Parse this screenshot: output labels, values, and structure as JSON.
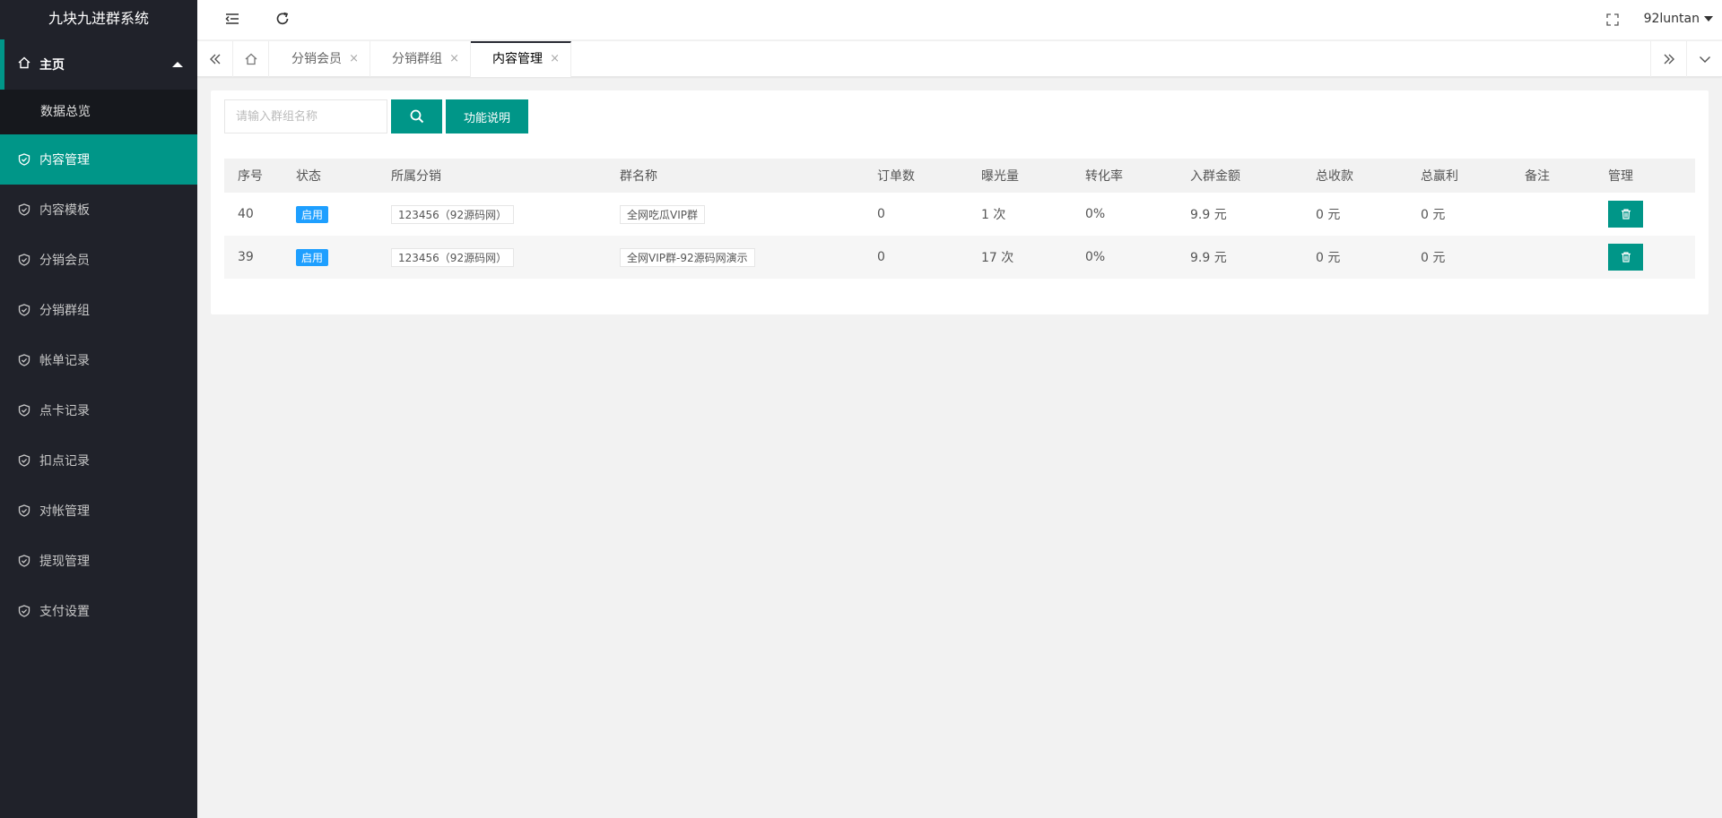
{
  "app": {
    "title": "九块九进群系统"
  },
  "sidebar": {
    "group": {
      "label": "主页",
      "items": [
        {
          "label": "数据总览"
        }
      ]
    },
    "items": [
      {
        "label": "内容管理",
        "active": true
      },
      {
        "label": "内容模板"
      },
      {
        "label": "分销会员"
      },
      {
        "label": "分销群组"
      },
      {
        "label": "帐单记录"
      },
      {
        "label": "点卡记录"
      },
      {
        "label": "扣点记录"
      },
      {
        "label": "对帐管理"
      },
      {
        "label": "提现管理"
      },
      {
        "label": "支付设置"
      }
    ]
  },
  "header": {
    "user": "92luntan"
  },
  "tabs": [
    {
      "label": "分销会员",
      "close": "×"
    },
    {
      "label": "分销群组",
      "close": "×"
    },
    {
      "label": "内容管理",
      "close": "×",
      "active": true
    }
  ],
  "toolbar": {
    "search_placeholder": "请输入群组名称",
    "help_label": "功能说明"
  },
  "table": {
    "headers": [
      "序号",
      "状态",
      "所属分销",
      "群名称",
      "订单数",
      "曝光量",
      "转化率",
      "入群金额",
      "总收款",
      "总赢利",
      "备注",
      "管理"
    ],
    "rows": [
      {
        "id": "40",
        "status": "启用",
        "distributor": "123456（92源码网）",
        "group": "全网吃瓜VIP群",
        "orders": "0",
        "views": "1 次",
        "rate": "0%",
        "price": "9.9 元",
        "income": "0 元",
        "profit": "0 元",
        "note": ""
      },
      {
        "id": "39",
        "status": "启用",
        "distributor": "123456（92源码网）",
        "group": "全网VIP群-92源码网演示",
        "orders": "0",
        "views": "17 次",
        "rate": "0%",
        "price": "9.9 元",
        "income": "0 元",
        "profit": "0 元",
        "note": ""
      }
    ]
  },
  "colors": {
    "accent": "#009688",
    "sidebar_bg": "#20222a",
    "badge": "#1E9FFF"
  },
  "icons": {
    "sidebar_group": "home-icon",
    "sidebar_items": "shield-check-icon",
    "header": [
      "menu-fold-icon",
      "refresh-icon",
      "fullscreen-icon"
    ],
    "tabbar": [
      "double-chevron-left-icon",
      "home-icon",
      "double-chevron-right-icon",
      "chevron-down-icon"
    ],
    "search": "search-icon",
    "delete": "trash-icon"
  }
}
